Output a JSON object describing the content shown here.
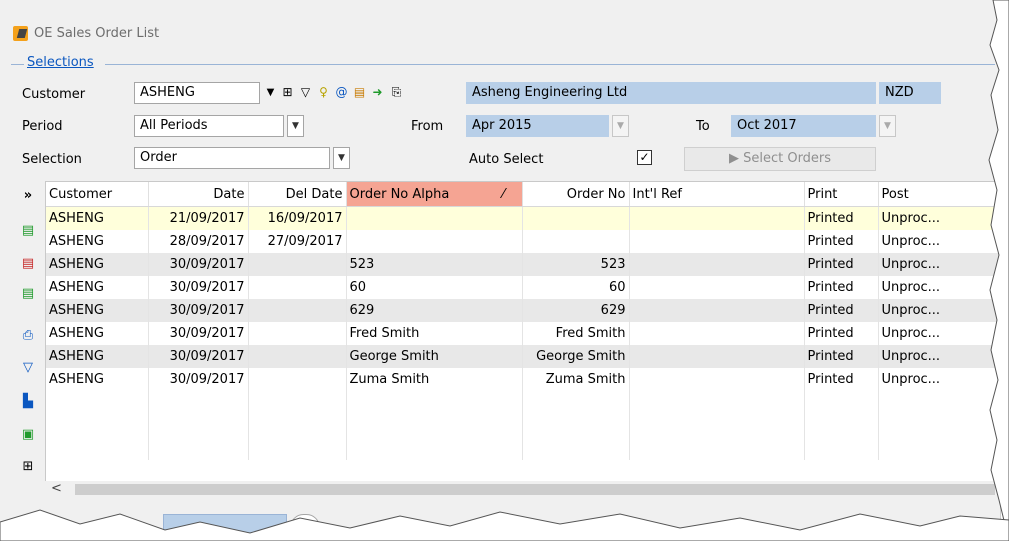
{
  "window": {
    "title": "OE Sales Order List",
    "icon": "app-logo-icon"
  },
  "selections": {
    "tab_label": "Selections",
    "customer_label": "Customer",
    "customer_value": "ASHENG",
    "customer_name": "Asheng Engineering Ltd",
    "currency": "NZD",
    "period_label": "Period",
    "period_value": "All Periods",
    "from_label": "From",
    "from_value": "Apr 2015",
    "to_label": "To",
    "to_value": "Oct 2017",
    "selection_label": "Selection",
    "selection_value": "Order",
    "auto_select_label": "Auto Select",
    "auto_select_checked": "✓",
    "select_orders_label": "Select Orders",
    "toolbar_icons": [
      "dropdown-arrow-icon",
      "binoculars-icon",
      "filter-icon",
      "bulb-icon",
      "attachment-icon",
      "note-icon",
      "green-arrow-icon",
      "search-document-icon"
    ]
  },
  "sidebar": {
    "expand_label": "»",
    "icons": [
      "add-document-icon",
      "remove-document-icon",
      "edit-document-icon",
      "print-icon",
      "clear-filter-icon",
      "chart-icon",
      "export-icon",
      "binoculars-icon"
    ]
  },
  "grid": {
    "columns": [
      "Customer",
      "Date",
      "Del Date",
      "Order No Alpha",
      "Order No",
      "Int'l Ref",
      "Print",
      "Post"
    ],
    "sort_indicator": "⁄",
    "rows": [
      [
        "ASHENG",
        "21/09/2017",
        "16/09/2017",
        "",
        "",
        "",
        "Printed",
        "Unproc..."
      ],
      [
        "ASHENG",
        "28/09/2017",
        "27/09/2017",
        "",
        "",
        "",
        "Printed",
        "Unproc..."
      ],
      [
        "ASHENG",
        "30/09/2017",
        "",
        "523",
        "523",
        "",
        "Printed",
        "Unproc..."
      ],
      [
        "ASHENG",
        "30/09/2017",
        "",
        "60",
        "60",
        "",
        "Printed",
        "Unproc..."
      ],
      [
        "ASHENG",
        "30/09/2017",
        "",
        "629",
        "629",
        "",
        "Printed",
        "Unproc..."
      ],
      [
        "ASHENG",
        "30/09/2017",
        "",
        "Fred Smith",
        "Fred Smith",
        "",
        "Printed",
        "Unproc..."
      ],
      [
        "ASHENG",
        "30/09/2017",
        "",
        "George Smith",
        "George Smith",
        "",
        "Printed",
        "Unproc..."
      ],
      [
        "ASHENG",
        "30/09/2017",
        "",
        "Zuma Smith",
        "Zuma Smith",
        "",
        "Printed",
        "Unproc..."
      ]
    ]
  },
  "scrollbar": {
    "left_arrow": "<"
  },
  "colors": {
    "accent_blue": "#b8cfe8",
    "sorted_header": "#f5a493",
    "highlight_row": "#ffffdb",
    "alt_row": "#e8e8e8",
    "link": "#0b57c0"
  }
}
